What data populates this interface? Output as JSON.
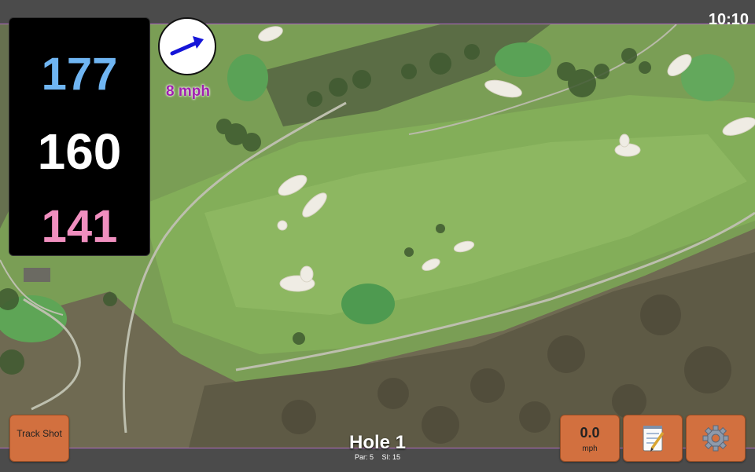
{
  "status": {
    "time": "10:10"
  },
  "distances": {
    "back": "177",
    "middle": "160",
    "front": "141"
  },
  "wind": {
    "speed": "8 mph",
    "direction_icon": "wind-arrow-icon"
  },
  "buttons": {
    "track_shot": "Track Shot",
    "speed_value": "0.0",
    "speed_unit": "mph",
    "notes_icon": "notepad-icon",
    "settings_icon": "gear-icon"
  },
  "hole": {
    "title": "Hole 1",
    "par": "Par: 5",
    "si": "SI: 15"
  },
  "colors": {
    "back": "#6fb5f2",
    "middle": "#ffffff",
    "front": "#f08fbf",
    "button": "#d2703f",
    "wind_text": "#a01fb0"
  }
}
